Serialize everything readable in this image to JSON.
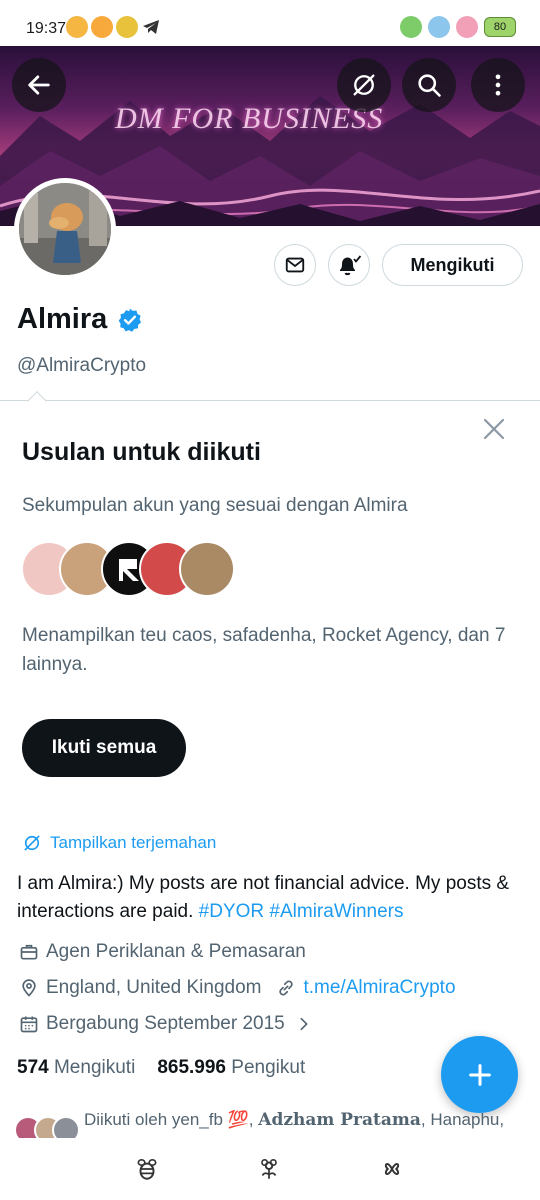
{
  "status_bar": {
    "time": "19:37",
    "battery": "80"
  },
  "banner": {
    "text": "DM FOR BUSINESS"
  },
  "profile": {
    "name": "Almira",
    "handle": "@AlmiraCrypto",
    "follow_button": "Mengikuti",
    "verified": true
  },
  "suggestions": {
    "title": "Usulan untuk diikuti",
    "subtitle": "Sekumpulan akun yang sesuai dengan Almira",
    "description": "Menampilkan teu caos, safadenha, Rocket Agency, dan 7 lainnya.",
    "follow_all": "Ikuti semua"
  },
  "bio": {
    "translate": "Tampilkan terjemahan",
    "text_plain": "I am Almira:) My posts are not financial advice. My posts & interactions are paid. ",
    "tag1": "#DYOR",
    "tag2": "#AlmiraWinners",
    "category": "Agen Periklanan & Pemasaran",
    "location": "England, United Kingdom",
    "link": "t.me/AlmiraCrypto",
    "joined": "Bergabung September 2015"
  },
  "stats": {
    "following_count": "574",
    "following_label": "Mengikuti",
    "followers_count": "865.996",
    "followers_label": "Pengikut"
  },
  "followed_by": {
    "prefix": "Diikuti oleh yen_fb 💯,",
    "bold_name": "Adzham Pratama",
    "suffix": ", Hanaphu,"
  },
  "colors": {
    "accent": "#1d9bf0",
    "text_primary": "#0f1419",
    "text_secondary": "#536471",
    "border": "#cfd9de"
  }
}
